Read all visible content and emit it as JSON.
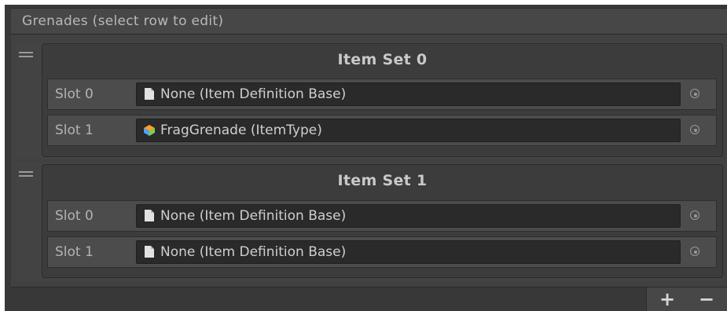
{
  "header": {
    "title": "Grenades (select row to edit)"
  },
  "item_sets": [
    {
      "title": "Item Set 0",
      "slots": [
        {
          "label": "Slot 0",
          "value": "None (Item Definition Base)",
          "icon": "document-icon"
        },
        {
          "label": "Slot 1",
          "value": "FragGrenade (ItemType)",
          "icon": "item-type-icon"
        }
      ]
    },
    {
      "title": "Item Set 1",
      "slots": [
        {
          "label": "Slot 0",
          "value": "None (Item Definition Base)",
          "icon": "document-icon"
        },
        {
          "label": "Slot 1",
          "value": "None (Item Definition Base)",
          "icon": "document-icon"
        }
      ]
    }
  ],
  "footer": {
    "add_label": "+",
    "remove_label": "−"
  },
  "colors": {
    "item_type_icon": [
      "#ff9d2e",
      "#4da3ff",
      "#7fd14a"
    ]
  }
}
